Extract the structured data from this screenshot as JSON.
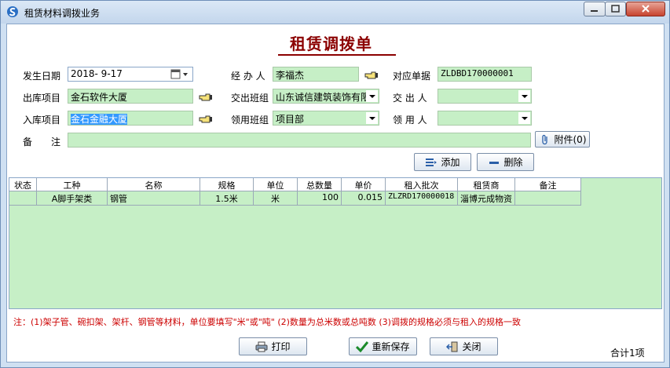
{
  "window": {
    "title": "租赁材料调拨业务"
  },
  "form": {
    "title": "租赁调拨单"
  },
  "fields": {
    "date_label": "发生日期",
    "date_value": "2018- 9-17",
    "operator_label": "经 办 人",
    "operator_value": "李福杰",
    "ref_label": "对应单据",
    "ref_value": "ZLDBD170000001",
    "out_project_label": "出库项目",
    "out_project_value": "金石软件大厦",
    "out_team_label": "交出班组",
    "out_team_value": "山东诚信建筑装饰有限",
    "out_person_label": "交 出 人",
    "out_person_value": "",
    "in_project_label": "入库项目",
    "in_project_value": "金石金融大厦",
    "in_team_label": "领用班组",
    "in_team_value": "项目部",
    "in_person_label": "领 用 人",
    "in_person_value": "",
    "remark_label": "备　　注",
    "remark_value": ""
  },
  "buttons": {
    "attach": "附件(0)",
    "add": "添加",
    "delete": "删除",
    "print": "打印",
    "resave": "重新保存",
    "close": "关闭"
  },
  "table": {
    "headers": [
      "状态",
      "工种",
      "名称",
      "规格",
      "单位",
      "总数量",
      "单价",
      "租入批次",
      "租赁商",
      "备注"
    ],
    "rows": [
      [
        "",
        "A脚手架类",
        "钢管",
        "1.5米",
        "米",
        "100",
        "0.015",
        "ZLZRD170000018",
        "淄博元成物资",
        ""
      ]
    ]
  },
  "footer": {
    "note": "注：(1)架子管、碗扣架、架杆、钢管等材料，单位要填写\"米\"或\"吨\"  (2)数量为总米数或总吨数  (3)调拨的规格必须与租入的规格一致",
    "total": "合计1项"
  },
  "icons": {
    "app": "app-s-icon",
    "calendar": "calendar-icon",
    "hand": "pointing-hand-icon",
    "paperclip": "paperclip-icon",
    "add": "add-list-icon",
    "delete": "minus-icon",
    "print": "printer-icon",
    "resave": "checkmark-icon",
    "close": "exit-door-icon"
  },
  "colors": {
    "field_bg": "#c6efc6",
    "title_red": "#8b0000",
    "note_red": "#cc0000"
  }
}
